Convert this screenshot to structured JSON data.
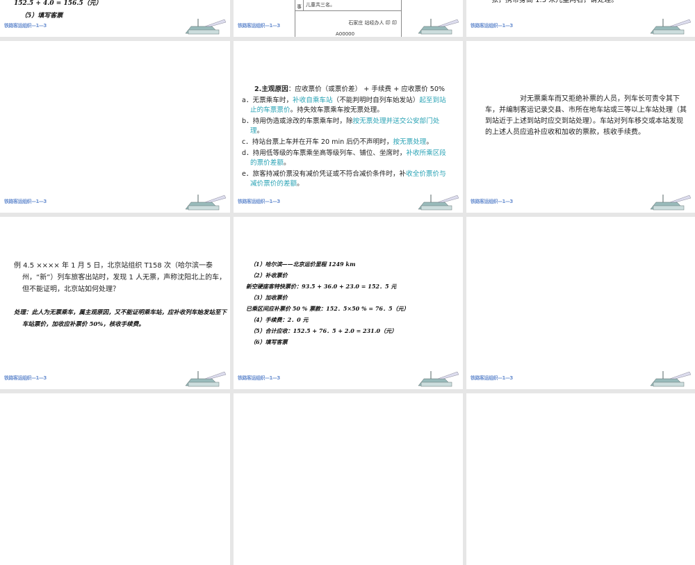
{
  "footer_label": "铁路客运组织—1—3",
  "slides": {
    "s1": {
      "line1": "152.5 + 4.0 = 156.5（元）",
      "line2": "（5）填写客票"
    },
    "s2": {
      "form_cell": "事",
      "form_text": "儿童共三名。",
      "form_sign": "石家庄  站经办人  印  印",
      "form_no": "A00000"
    },
    "s3": {
      "line1": "张，携带身高 1.3 米儿童两名，请处理。"
    },
    "s5": {
      "heading_num": "2.",
      "heading_bold": "主观原因",
      "heading_rest": "：应收票价（或票价差） + 手续费 + 应收票价 50%",
      "items": [
        {
          "prefix": "a．无票乘车时，",
          "hl": "补收自乘车站",
          "mid": "（不能判明时自列车始发站）",
          "hl2": "起至到站止的车票票价",
          "rest": "。持失效车票乘车按无票处理。"
        },
        {
          "prefix": "b．持用伪造或涂改的车票乘车时，除",
          "hl": "按无票处理并送交公安部门处理",
          "rest": "。"
        },
        {
          "prefix": "c．持站台票上车并在开车 20 min 后仍不声明时，",
          "hl": "按无票处理",
          "rest": "。"
        },
        {
          "prefix": "d．持用低等级的车票乘坐高等级列车、铺位、坐席时，",
          "hl": "补收所乘区段的票价差额",
          "rest": "。"
        },
        {
          "prefix": "e．旅客持减价票没有减价凭证或不符合减价条件时，补",
          "hl": "收全价票价与减价票价的差额",
          "rest": "。"
        }
      ]
    },
    "s6": {
      "text": "对无票乘车而又拒绝补票的人员，列车长可责令其下车，并编制客运记录交县、市所在地车站或三等以上车站处理（其到站近于上述到站时应交到站处理）。车站对列车移交或本站发现的上述人员应追补应收和加收的票款，核收手续费。"
    },
    "s7": {
      "question": "例 4.5  ×××× 年 1 月 5 日，北京站组织 T158 次（哈尔滨一泰州，“新”）列车旅客出站时，发现 1 人无票，声称沈阳北上的车，但不能证明，北京站如何处理？",
      "answer": "处理：此人为无票乘车，属主观原因，又不能证明乘车站，应补收列车始发站至下车站票价，加收应补票价 50%，核收手续费。"
    },
    "s8": {
      "lines": [
        "（1）哈尔滨——北京运价里程 1249 km",
        "（2）补收票价",
        "新空硬座客特快票价：93.5 + 36.0 + 23.0 = 152．5 元",
        "（3）加收票价",
        "已乘区间应补票价 50 % 票款：152．5×50 % = 76．5（元）",
        "（4）手续费：2．0 元",
        "（5）合计应收：152.5 + 76．5 + 2.0 = 231.0（元）",
        "（6）填写客票"
      ]
    }
  }
}
